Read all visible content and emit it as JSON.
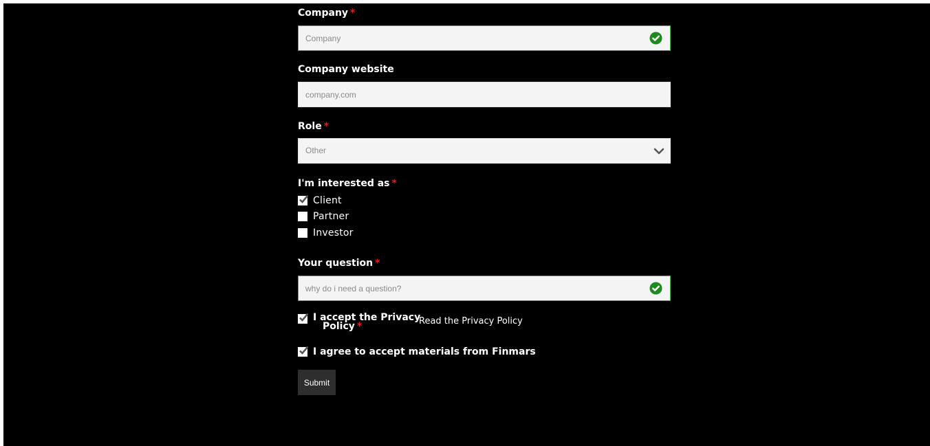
{
  "company": {
    "label": "Company",
    "required_mark": "*",
    "placeholder": "Company",
    "valid_icon": "check-circle-icon"
  },
  "website": {
    "label": "Company website",
    "placeholder": "company.com"
  },
  "role": {
    "label": "Role",
    "required_mark": "*",
    "selected": "Other",
    "icon": "chevron-down-icon"
  },
  "interest": {
    "label": "I'm interested as",
    "required_mark": "*",
    "options": [
      {
        "label": "Client",
        "checked": true
      },
      {
        "label": "Partner",
        "checked": false
      },
      {
        "label": "Investor",
        "checked": false
      }
    ]
  },
  "question": {
    "label": "Your question",
    "required_mark": "*",
    "placeholder": "why do i need a question?",
    "valid_icon": "check-circle-icon"
  },
  "privacy": {
    "label_line1": "I accept the Privacy",
    "label_line2": "Policy",
    "required_mark": "*",
    "checked": true,
    "link_text": "Read the Privacy Policy"
  },
  "materials": {
    "label": "I agree to accept materials from Finmars",
    "checked": true
  },
  "submit_label": "Submit",
  "colors": {
    "background": "#000000",
    "field_bg": "#f4f4f4",
    "valid_border": "#35b535",
    "valid_icon": "#1e8a1e",
    "required": "#e02020",
    "button": "#2e2e2e"
  }
}
